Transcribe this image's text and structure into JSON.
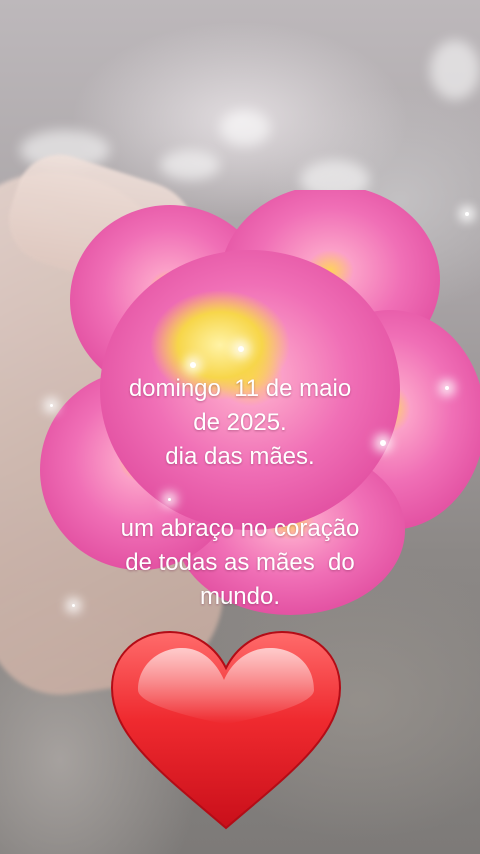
{
  "message": {
    "date_lines": [
      "domingo  11 de maio",
      "de 2025.",
      "dia das mães."
    ],
    "greeting_lines": [
      "um abraço no coração",
      "de todas as mães  do",
      "mundo."
    ]
  },
  "colors": {
    "petal": "#f06fb6",
    "petal_light": "#f8a6d6",
    "flower_center": "#f7d64a",
    "heart": "#e8232b",
    "text": "#ffffff"
  },
  "icons": [
    "flower-image",
    "heart-icon"
  ]
}
